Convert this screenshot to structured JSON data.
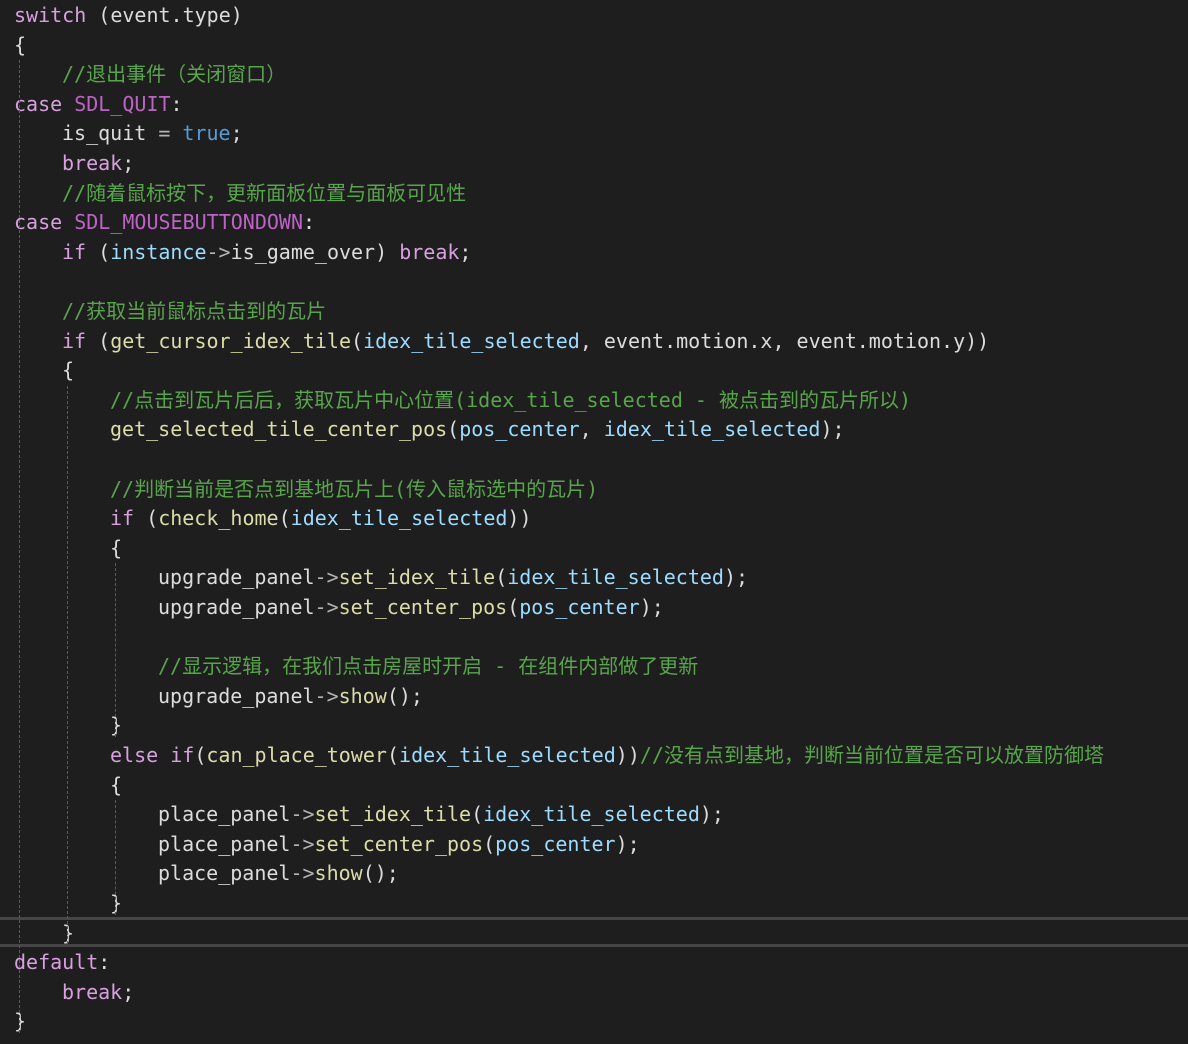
{
  "editor": {
    "lines": [
      {
        "indent": 0,
        "tokens": [
          {
            "t": "switch",
            "c": "kw2"
          },
          {
            "t": " (event.type)",
            "c": "pl"
          }
        ]
      },
      {
        "indent": 0,
        "tokens": [
          {
            "t": "{",
            "c": "pl"
          }
        ]
      },
      {
        "indent": 1,
        "tokens": [
          {
            "t": "//退出事件（关闭窗口）",
            "c": "cm"
          }
        ]
      },
      {
        "indent": 0,
        "tokens": [
          {
            "t": "case",
            "c": "kw2"
          },
          {
            "t": " SDL_QUIT",
            "c": "mac"
          },
          {
            "t": ":",
            "c": "pl"
          }
        ]
      },
      {
        "indent": 1,
        "tokens": [
          {
            "t": "is_quit",
            "c": "pl"
          },
          {
            "t": " = ",
            "c": "op"
          },
          {
            "t": "true",
            "c": "kw"
          },
          {
            "t": ";",
            "c": "pl"
          }
        ]
      },
      {
        "indent": 1,
        "tokens": [
          {
            "t": "break",
            "c": "kw2"
          },
          {
            "t": ";",
            "c": "pl"
          }
        ]
      },
      {
        "indent": 1,
        "tokens": [
          {
            "t": "//随着鼠标按下，更新面板位置与面板可见性",
            "c": "cm"
          }
        ]
      },
      {
        "indent": 0,
        "tokens": [
          {
            "t": "case",
            "c": "kw2"
          },
          {
            "t": " SDL_MOUSEBUTTONDOWN",
            "c": "mac"
          },
          {
            "t": ":",
            "c": "pl"
          }
        ]
      },
      {
        "indent": 1,
        "tokens": [
          {
            "t": "if",
            "c": "kw2"
          },
          {
            "t": " (",
            "c": "pl"
          },
          {
            "t": "instance",
            "c": "id"
          },
          {
            "t": "->",
            "c": "op"
          },
          {
            "t": "is_game_over",
            "c": "pl"
          },
          {
            "t": ") ",
            "c": "pl"
          },
          {
            "t": "break",
            "c": "kw2"
          },
          {
            "t": ";",
            "c": "pl"
          }
        ]
      },
      {
        "indent": 1,
        "tokens": []
      },
      {
        "indent": 1,
        "tokens": [
          {
            "t": "//获取当前鼠标点击到的瓦片",
            "c": "cm"
          }
        ]
      },
      {
        "indent": 1,
        "tokens": [
          {
            "t": "if",
            "c": "kw2"
          },
          {
            "t": " (",
            "c": "pl"
          },
          {
            "t": "get_cursor_idex_tile",
            "c": "fn"
          },
          {
            "t": "(",
            "c": "pl"
          },
          {
            "t": "idex_tile_selected",
            "c": "id"
          },
          {
            "t": ", event.motion.x, event.motion.y))",
            "c": "pl"
          }
        ]
      },
      {
        "indent": 1,
        "tokens": [
          {
            "t": "{",
            "c": "pl"
          }
        ]
      },
      {
        "indent": 2,
        "tokens": [
          {
            "t": "//点击到瓦片后后，获取瓦片中心位置(idex_tile_selected - 被点击到的瓦片所以)",
            "c": "cm"
          }
        ]
      },
      {
        "indent": 2,
        "tokens": [
          {
            "t": "get_selected_tile_center_pos",
            "c": "fn"
          },
          {
            "t": "(",
            "c": "pl"
          },
          {
            "t": "pos_center",
            "c": "id"
          },
          {
            "t": ", ",
            "c": "pl"
          },
          {
            "t": "idex_tile_selected",
            "c": "id"
          },
          {
            "t": ");",
            "c": "pl"
          }
        ]
      },
      {
        "indent": 2,
        "tokens": []
      },
      {
        "indent": 2,
        "tokens": [
          {
            "t": "//判断当前是否点到基地瓦片上(传入鼠标选中的瓦片)",
            "c": "cm"
          }
        ]
      },
      {
        "indent": 2,
        "tokens": [
          {
            "t": "if",
            "c": "kw2"
          },
          {
            "t": " (",
            "c": "pl"
          },
          {
            "t": "check_home",
            "c": "fn"
          },
          {
            "t": "(",
            "c": "pl"
          },
          {
            "t": "idex_tile_selected",
            "c": "id"
          },
          {
            "t": "))",
            "c": "pl"
          }
        ]
      },
      {
        "indent": 2,
        "tokens": [
          {
            "t": "{",
            "c": "pl"
          }
        ]
      },
      {
        "indent": 3,
        "tokens": [
          {
            "t": "upgrade_panel",
            "c": "pl"
          },
          {
            "t": "->",
            "c": "op"
          },
          {
            "t": "set_idex_tile",
            "c": "fn"
          },
          {
            "t": "(",
            "c": "pl"
          },
          {
            "t": "idex_tile_selected",
            "c": "id"
          },
          {
            "t": ");",
            "c": "pl"
          }
        ]
      },
      {
        "indent": 3,
        "tokens": [
          {
            "t": "upgrade_panel",
            "c": "pl"
          },
          {
            "t": "->",
            "c": "op"
          },
          {
            "t": "set_center_pos",
            "c": "fn"
          },
          {
            "t": "(",
            "c": "pl"
          },
          {
            "t": "pos_center",
            "c": "id"
          },
          {
            "t": ");",
            "c": "pl"
          }
        ]
      },
      {
        "indent": 3,
        "tokens": []
      },
      {
        "indent": 3,
        "tokens": [
          {
            "t": "//显示逻辑，在我们点击房屋时开启 - 在组件内部做了更新",
            "c": "cm"
          }
        ]
      },
      {
        "indent": 3,
        "tokens": [
          {
            "t": "upgrade_panel",
            "c": "pl"
          },
          {
            "t": "->",
            "c": "op"
          },
          {
            "t": "show",
            "c": "fn"
          },
          {
            "t": "();",
            "c": "pl"
          }
        ]
      },
      {
        "indent": 2,
        "tokens": [
          {
            "t": "}",
            "c": "pl"
          }
        ]
      },
      {
        "indent": 2,
        "tokens": [
          {
            "t": "else",
            "c": "kw2"
          },
          {
            "t": " ",
            "c": "pl"
          },
          {
            "t": "if",
            "c": "kw2"
          },
          {
            "t": "(",
            "c": "pl"
          },
          {
            "t": "can_place_tower",
            "c": "fn"
          },
          {
            "t": "(",
            "c": "pl"
          },
          {
            "t": "idex_tile_selected",
            "c": "id"
          },
          {
            "t": "))",
            "c": "pl"
          },
          {
            "t": "//没有点到基地，判断当前位置是否可以放置防御塔",
            "c": "cm"
          }
        ]
      },
      {
        "indent": 2,
        "tokens": [
          {
            "t": "{",
            "c": "pl"
          }
        ]
      },
      {
        "indent": 3,
        "tokens": [
          {
            "t": "place_panel",
            "c": "pl"
          },
          {
            "t": "->",
            "c": "op"
          },
          {
            "t": "set_idex_tile",
            "c": "fn"
          },
          {
            "t": "(",
            "c": "pl"
          },
          {
            "t": "idex_tile_selected",
            "c": "id"
          },
          {
            "t": ");",
            "c": "pl"
          }
        ]
      },
      {
        "indent": 3,
        "tokens": [
          {
            "t": "place_panel",
            "c": "pl"
          },
          {
            "t": "->",
            "c": "op"
          },
          {
            "t": "set_center_pos",
            "c": "fn"
          },
          {
            "t": "(",
            "c": "pl"
          },
          {
            "t": "pos_center",
            "c": "id"
          },
          {
            "t": ");",
            "c": "pl"
          }
        ]
      },
      {
        "indent": 3,
        "tokens": [
          {
            "t": "place_panel",
            "c": "pl"
          },
          {
            "t": "->",
            "c": "op"
          },
          {
            "t": "show",
            "c": "fn"
          },
          {
            "t": "();",
            "c": "pl"
          }
        ]
      },
      {
        "indent": 2,
        "tokens": [
          {
            "t": "}",
            "c": "pl"
          }
        ]
      },
      {
        "indent": 1,
        "tokens": [
          {
            "t": "}",
            "c": "pl"
          }
        ]
      },
      {
        "indent": 0,
        "tokens": [
          {
            "t": "default",
            "c": "kw2"
          },
          {
            "t": ":",
            "c": "pl"
          }
        ]
      },
      {
        "indent": 1,
        "tokens": [
          {
            "t": "break",
            "c": "kw2"
          },
          {
            "t": ";",
            "c": "pl"
          }
        ]
      },
      {
        "indent": 0,
        "tokens": [
          {
            "t": "}",
            "c": "pl"
          }
        ]
      }
    ],
    "guides": [
      {
        "col": 0,
        "from": 2,
        "to": 34
      },
      {
        "col": 1,
        "from": 13,
        "to": 31
      },
      {
        "col": 2,
        "from": 19,
        "to": 24
      },
      {
        "col": 2,
        "from": 27,
        "to": 30
      }
    ],
    "current_line": 31
  }
}
